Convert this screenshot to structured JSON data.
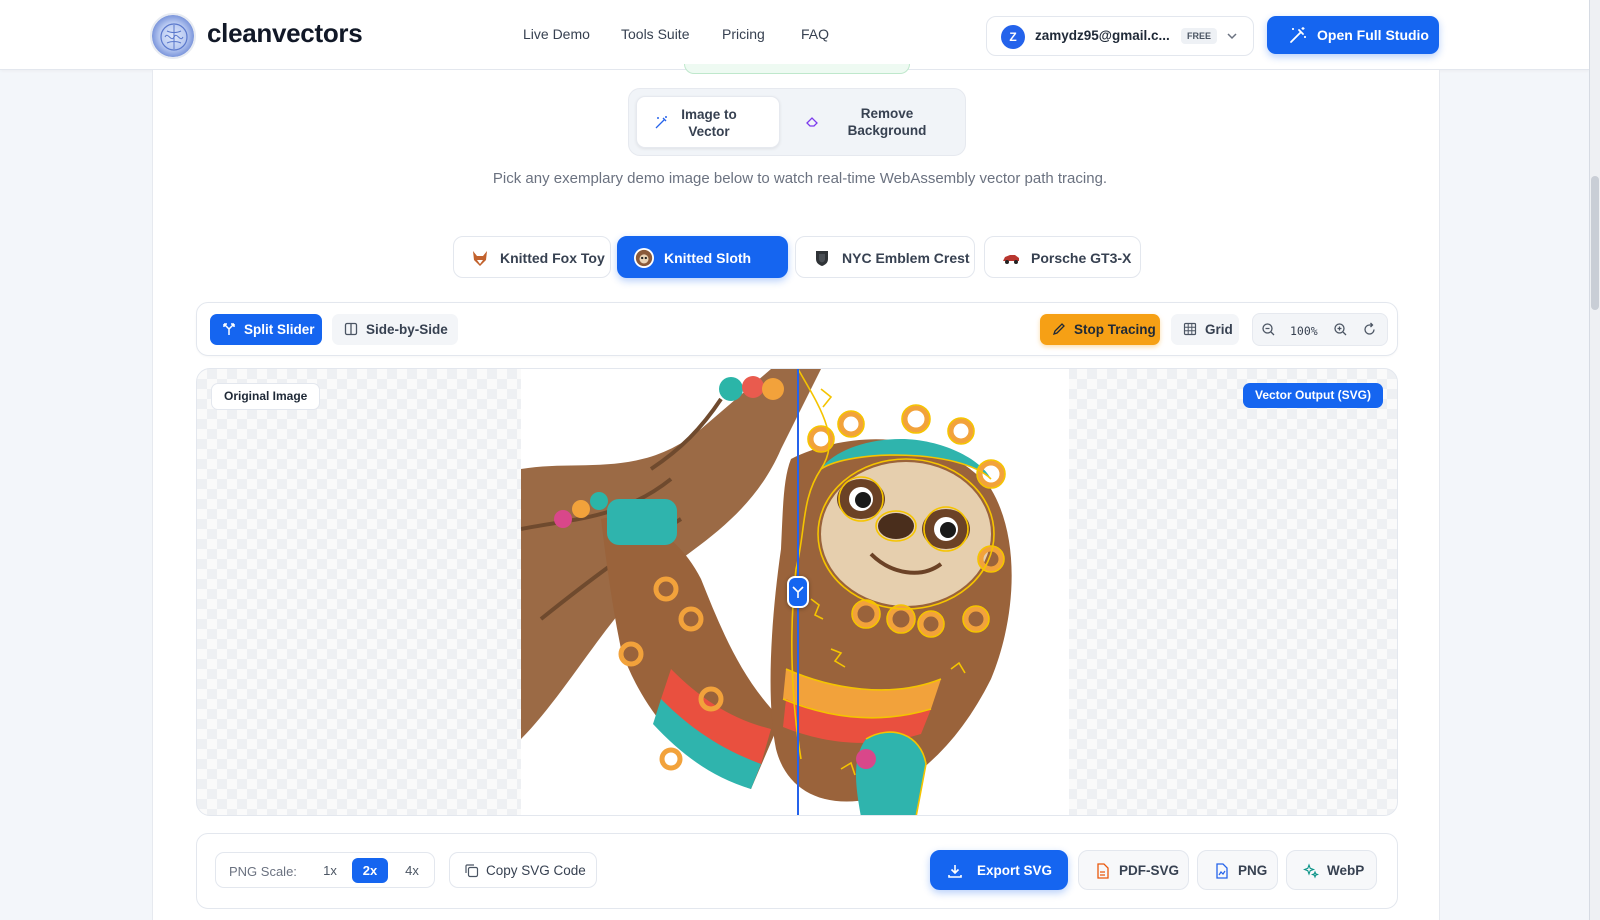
{
  "brand": {
    "name": "cleanvectors"
  },
  "nav": {
    "items": [
      "Live Demo",
      "Tools Suite",
      "Pricing",
      "FAQ"
    ]
  },
  "account": {
    "initial": "Z",
    "email": "zamydz95@gmail.c...",
    "plan": "FREE"
  },
  "header": {
    "cta": "Open Full Studio"
  },
  "modes": {
    "image_to_vector": "Image to Vector",
    "remove_background": "Remove Background",
    "selected": "Image to Vector"
  },
  "hint": "Pick any exemplary demo image below to watch real-time WebAssembly vector path tracing.",
  "demos": {
    "items": [
      "Knitted Fox Toy",
      "Knitted Sloth",
      "NYC Emblem Crest",
      "Porsche GT3-X"
    ],
    "selected": "Knitted Sloth"
  },
  "toolbar": {
    "split_slider": "Split Slider",
    "side_by_side": "Side-by-Side",
    "stop_tracing": "Stop Tracing",
    "grid": "Grid",
    "zoom": "100%"
  },
  "canvas": {
    "original_label": "Original Image",
    "vector_label": "Vector Output (SVG)",
    "split_fraction": 0.5
  },
  "export": {
    "png_scale_label": "PNG Scale:",
    "scales": [
      "1x",
      "2x",
      "4x"
    ],
    "selected_scale": "2x",
    "copy_svg": "Copy SVG Code",
    "export_svg": "Export SVG",
    "pdf_svg": "PDF-SVG",
    "png": "PNG",
    "webp": "WebP"
  },
  "colors": {
    "accent": "#1565f0",
    "warning": "#f59e0b",
    "trace_outline": "#f5c400"
  }
}
